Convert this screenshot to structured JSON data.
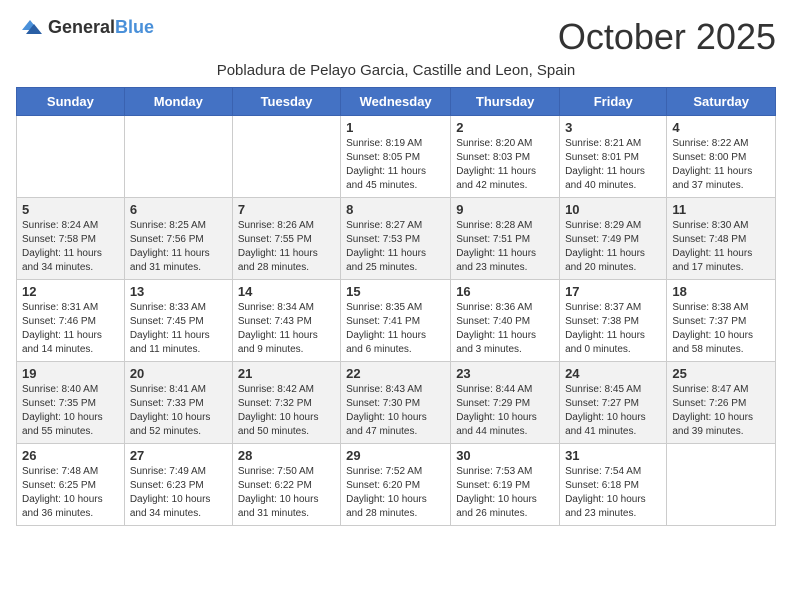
{
  "header": {
    "logo_general": "General",
    "logo_blue": "Blue",
    "month_title": "October 2025",
    "subtitle": "Pobladura de Pelayo Garcia, Castille and Leon, Spain"
  },
  "weekdays": [
    "Sunday",
    "Monday",
    "Tuesday",
    "Wednesday",
    "Thursday",
    "Friday",
    "Saturday"
  ],
  "weeks": [
    [
      {
        "day": "",
        "sunrise": "",
        "sunset": "",
        "daylight": ""
      },
      {
        "day": "",
        "sunrise": "",
        "sunset": "",
        "daylight": ""
      },
      {
        "day": "",
        "sunrise": "",
        "sunset": "",
        "daylight": ""
      },
      {
        "day": "1",
        "sunrise": "Sunrise: 8:19 AM",
        "sunset": "Sunset: 8:05 PM",
        "daylight": "Daylight: 11 hours and 45 minutes."
      },
      {
        "day": "2",
        "sunrise": "Sunrise: 8:20 AM",
        "sunset": "Sunset: 8:03 PM",
        "daylight": "Daylight: 11 hours and 42 minutes."
      },
      {
        "day": "3",
        "sunrise": "Sunrise: 8:21 AM",
        "sunset": "Sunset: 8:01 PM",
        "daylight": "Daylight: 11 hours and 40 minutes."
      },
      {
        "day": "4",
        "sunrise": "Sunrise: 8:22 AM",
        "sunset": "Sunset: 8:00 PM",
        "daylight": "Daylight: 11 hours and 37 minutes."
      }
    ],
    [
      {
        "day": "5",
        "sunrise": "Sunrise: 8:24 AM",
        "sunset": "Sunset: 7:58 PM",
        "daylight": "Daylight: 11 hours and 34 minutes."
      },
      {
        "day": "6",
        "sunrise": "Sunrise: 8:25 AM",
        "sunset": "Sunset: 7:56 PM",
        "daylight": "Daylight: 11 hours and 31 minutes."
      },
      {
        "day": "7",
        "sunrise": "Sunrise: 8:26 AM",
        "sunset": "Sunset: 7:55 PM",
        "daylight": "Daylight: 11 hours and 28 minutes."
      },
      {
        "day": "8",
        "sunrise": "Sunrise: 8:27 AM",
        "sunset": "Sunset: 7:53 PM",
        "daylight": "Daylight: 11 hours and 25 minutes."
      },
      {
        "day": "9",
        "sunrise": "Sunrise: 8:28 AM",
        "sunset": "Sunset: 7:51 PM",
        "daylight": "Daylight: 11 hours and 23 minutes."
      },
      {
        "day": "10",
        "sunrise": "Sunrise: 8:29 AM",
        "sunset": "Sunset: 7:49 PM",
        "daylight": "Daylight: 11 hours and 20 minutes."
      },
      {
        "day": "11",
        "sunrise": "Sunrise: 8:30 AM",
        "sunset": "Sunset: 7:48 PM",
        "daylight": "Daylight: 11 hours and 17 minutes."
      }
    ],
    [
      {
        "day": "12",
        "sunrise": "Sunrise: 8:31 AM",
        "sunset": "Sunset: 7:46 PM",
        "daylight": "Daylight: 11 hours and 14 minutes."
      },
      {
        "day": "13",
        "sunrise": "Sunrise: 8:33 AM",
        "sunset": "Sunset: 7:45 PM",
        "daylight": "Daylight: 11 hours and 11 minutes."
      },
      {
        "day": "14",
        "sunrise": "Sunrise: 8:34 AM",
        "sunset": "Sunset: 7:43 PM",
        "daylight": "Daylight: 11 hours and 9 minutes."
      },
      {
        "day": "15",
        "sunrise": "Sunrise: 8:35 AM",
        "sunset": "Sunset: 7:41 PM",
        "daylight": "Daylight: 11 hours and 6 minutes."
      },
      {
        "day": "16",
        "sunrise": "Sunrise: 8:36 AM",
        "sunset": "Sunset: 7:40 PM",
        "daylight": "Daylight: 11 hours and 3 minutes."
      },
      {
        "day": "17",
        "sunrise": "Sunrise: 8:37 AM",
        "sunset": "Sunset: 7:38 PM",
        "daylight": "Daylight: 11 hours and 0 minutes."
      },
      {
        "day": "18",
        "sunrise": "Sunrise: 8:38 AM",
        "sunset": "Sunset: 7:37 PM",
        "daylight": "Daylight: 10 hours and 58 minutes."
      }
    ],
    [
      {
        "day": "19",
        "sunrise": "Sunrise: 8:40 AM",
        "sunset": "Sunset: 7:35 PM",
        "daylight": "Daylight: 10 hours and 55 minutes."
      },
      {
        "day": "20",
        "sunrise": "Sunrise: 8:41 AM",
        "sunset": "Sunset: 7:33 PM",
        "daylight": "Daylight: 10 hours and 52 minutes."
      },
      {
        "day": "21",
        "sunrise": "Sunrise: 8:42 AM",
        "sunset": "Sunset: 7:32 PM",
        "daylight": "Daylight: 10 hours and 50 minutes."
      },
      {
        "day": "22",
        "sunrise": "Sunrise: 8:43 AM",
        "sunset": "Sunset: 7:30 PM",
        "daylight": "Daylight: 10 hours and 47 minutes."
      },
      {
        "day": "23",
        "sunrise": "Sunrise: 8:44 AM",
        "sunset": "Sunset: 7:29 PM",
        "daylight": "Daylight: 10 hours and 44 minutes."
      },
      {
        "day": "24",
        "sunrise": "Sunrise: 8:45 AM",
        "sunset": "Sunset: 7:27 PM",
        "daylight": "Daylight: 10 hours and 41 minutes."
      },
      {
        "day": "25",
        "sunrise": "Sunrise: 8:47 AM",
        "sunset": "Sunset: 7:26 PM",
        "daylight": "Daylight: 10 hours and 39 minutes."
      }
    ],
    [
      {
        "day": "26",
        "sunrise": "Sunrise: 7:48 AM",
        "sunset": "Sunset: 6:25 PM",
        "daylight": "Daylight: 10 hours and 36 minutes."
      },
      {
        "day": "27",
        "sunrise": "Sunrise: 7:49 AM",
        "sunset": "Sunset: 6:23 PM",
        "daylight": "Daylight: 10 hours and 34 minutes."
      },
      {
        "day": "28",
        "sunrise": "Sunrise: 7:50 AM",
        "sunset": "Sunset: 6:22 PM",
        "daylight": "Daylight: 10 hours and 31 minutes."
      },
      {
        "day": "29",
        "sunrise": "Sunrise: 7:52 AM",
        "sunset": "Sunset: 6:20 PM",
        "daylight": "Daylight: 10 hours and 28 minutes."
      },
      {
        "day": "30",
        "sunrise": "Sunrise: 7:53 AM",
        "sunset": "Sunset: 6:19 PM",
        "daylight": "Daylight: 10 hours and 26 minutes."
      },
      {
        "day": "31",
        "sunrise": "Sunrise: 7:54 AM",
        "sunset": "Sunset: 6:18 PM",
        "daylight": "Daylight: 10 hours and 23 minutes."
      },
      {
        "day": "",
        "sunrise": "",
        "sunset": "",
        "daylight": ""
      }
    ]
  ]
}
